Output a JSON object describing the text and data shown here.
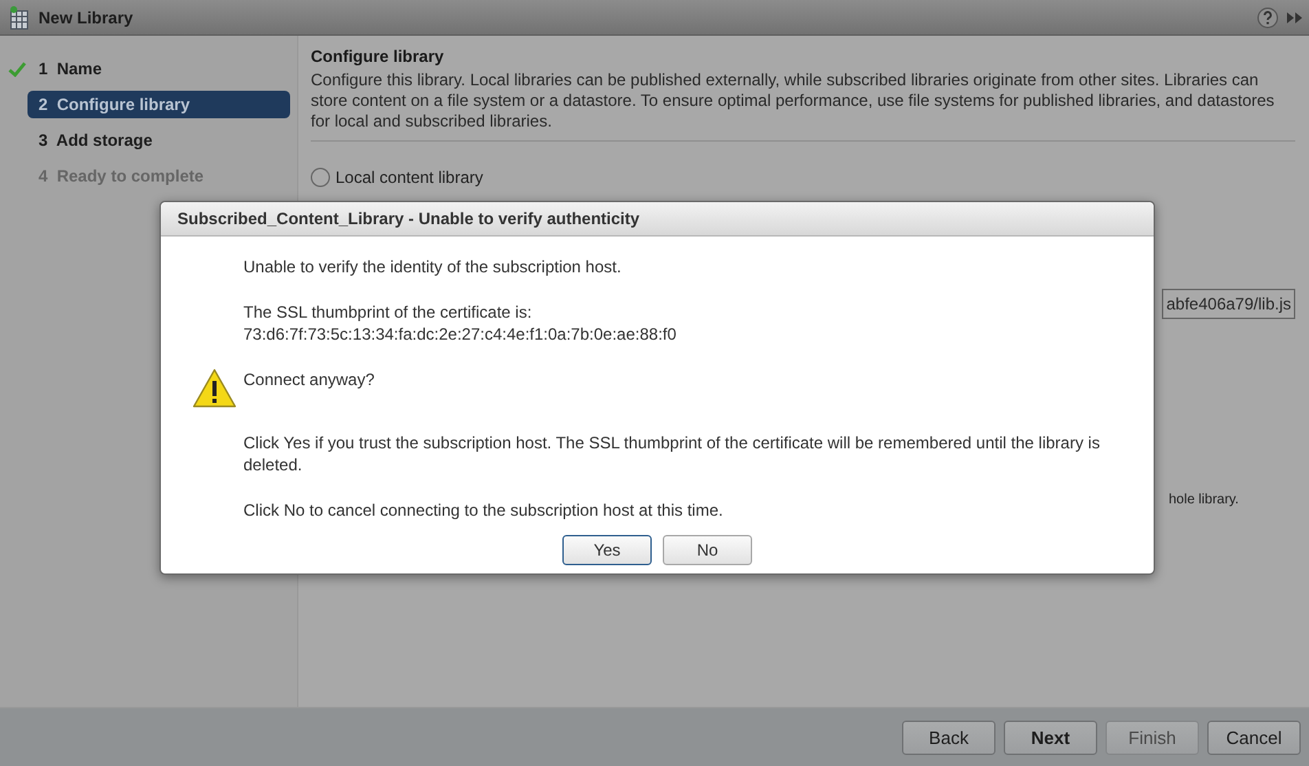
{
  "window": {
    "title": "New Library"
  },
  "steps": [
    {
      "number": "1",
      "label": "Name",
      "completed": true,
      "selected": false,
      "disabled": false
    },
    {
      "number": "2",
      "label": "Configure library",
      "completed": false,
      "selected": true,
      "disabled": false
    },
    {
      "number": "3",
      "label": "Add storage",
      "completed": false,
      "selected": false,
      "disabled": false
    },
    {
      "number": "4",
      "label": "Ready to complete",
      "completed": false,
      "selected": false,
      "disabled": true
    }
  ],
  "content": {
    "heading": "Configure library",
    "description": "Configure this library. Local libraries can be published externally, while subscribed libraries originate from other sites. Libraries can store content on a file system or a datastore. To ensure optimal performance, use file systems for published libraries, and datastores for local and subscribed libraries.",
    "options": [
      {
        "label": "Local content library",
        "selected": false
      }
    ],
    "url_field": {
      "value": "abfe406a79/lib.js"
    },
    "note": "hole library."
  },
  "dialog": {
    "title": "Subscribed_Content_Library - Unable to verify authenticity",
    "paragraphs": [
      {
        "kind": "plain",
        "lines": [
          "Unable to verify the identity of the subscription host."
        ]
      },
      {
        "kind": "plain",
        "lines": [
          "The SSL thumbprint of the certificate is:",
          "73:d6:7f:73:5c:13:34:fa:dc:2e:27:c4:4e:f1:0a:7b:0e:ae:88:f0"
        ]
      },
      {
        "kind": "warning",
        "lines": [
          "Connect anyway?"
        ]
      },
      {
        "kind": "plain",
        "lines": [
          "Click Yes if you trust the subscription host. The SSL thumbprint of the certificate will be remembered until the library is deleted."
        ]
      },
      {
        "kind": "plain",
        "lines": [
          "Click No to cancel connecting to the subscription host at this time."
        ]
      }
    ],
    "buttons": [
      {
        "label": "Yes",
        "default": true
      },
      {
        "label": "No",
        "default": false
      }
    ]
  },
  "footer": {
    "buttons": [
      {
        "label": "Back",
        "primary": false,
        "disabled": false
      },
      {
        "label": "Next",
        "primary": true,
        "disabled": false
      },
      {
        "label": "Finish",
        "primary": false,
        "disabled": true
      },
      {
        "label": "Cancel",
        "primary": false,
        "disabled": false
      }
    ]
  }
}
